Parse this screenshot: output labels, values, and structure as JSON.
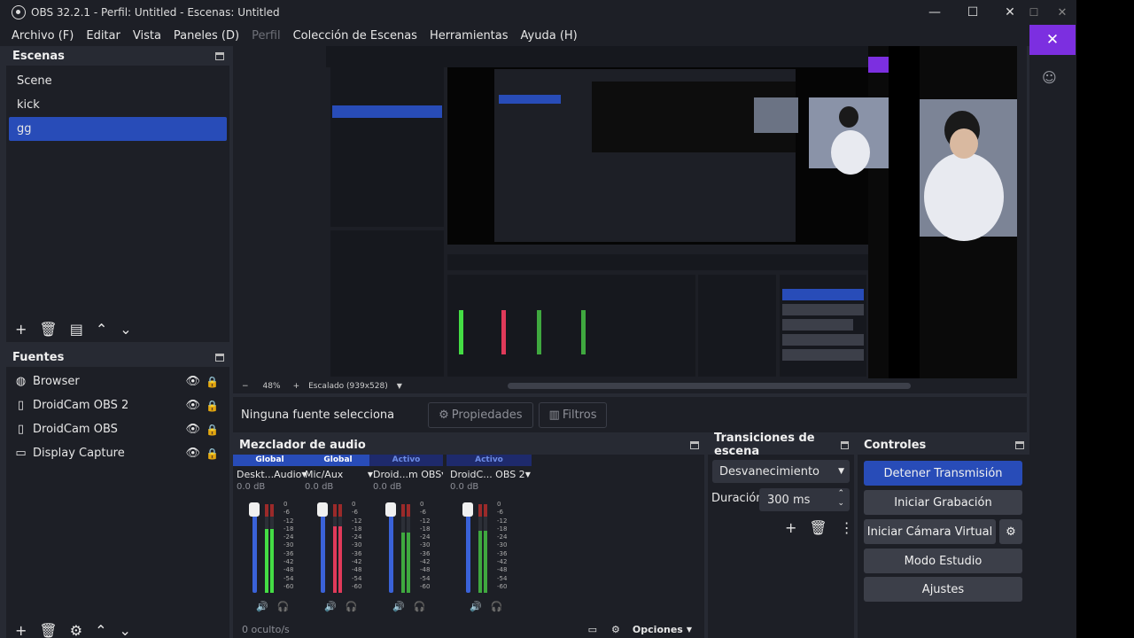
{
  "window": {
    "title": "OBS 32.2.1 - Perfil: Untitled - Escenas: Untitled",
    "controls": {
      "minimize": "—",
      "maximize": "☐",
      "close": "✕"
    },
    "outer_controls": {
      "maximize": "☐",
      "close": "✕"
    }
  },
  "menu": {
    "items": [
      "Archivo (F)",
      "Editar",
      "Vista",
      "Paneles (D)",
      "Perfil",
      "Colección de Escenas",
      "Herramientas",
      "Ayuda (H)"
    ],
    "disabled_index": 4
  },
  "scenes": {
    "title": "Escenas",
    "items": [
      "Scene",
      "kick",
      "gg"
    ],
    "selected_index": 2
  },
  "sources": {
    "title": "Fuentes",
    "items": [
      {
        "label": "Browser",
        "icon": "globe-icon"
      },
      {
        "label": "DroidCam OBS 2",
        "icon": "file-icon"
      },
      {
        "label": "DroidCam OBS",
        "icon": "file-icon"
      },
      {
        "label": "Display Capture",
        "icon": "monitor-icon"
      }
    ]
  },
  "preview_status": {
    "zoom": "48%",
    "scaling": "Escalado (939x528)",
    "zoom_out": "−",
    "zoom_in": "+"
  },
  "context": {
    "label": "Ninguna fuente selecciona",
    "properties": "Propiedades",
    "filters": "Filtros"
  },
  "mixer": {
    "title": "Mezclador de audio",
    "channels": [
      {
        "badge": "Global",
        "name": "Deskt...Audio",
        "db": "0.0 dB",
        "color": "#44dd44",
        "level": 0.72
      },
      {
        "badge": "Global",
        "name": "Mic/Aux",
        "db": "0.0 dB",
        "color": "#e03a5a",
        "level": 0.75
      },
      {
        "badge": "Activo",
        "name": "Droid...m OBS",
        "db": "0.0 dB",
        "color": "#3fa83f",
        "level": 0.68
      },
      {
        "badge": "Activo",
        "name": "DroidC... OBS 2",
        "db": "0.0 dB",
        "color": "#3fa83f",
        "level": 0.7
      }
    ],
    "ticks": [
      "0",
      "-6",
      "-12",
      "-18",
      "-24",
      "-30",
      "-36",
      "-42",
      "-48",
      "-54",
      "-60"
    ],
    "hidden_label": "0 oculto/s",
    "options_label": "Opciones"
  },
  "transitions": {
    "title": "Transiciones de escena",
    "selected": "Desvanecimiento",
    "duration_label": "Duración",
    "duration_value": "300 ms"
  },
  "controls": {
    "title": "Controles",
    "stop_stream": "Detener Transmisión",
    "start_recording": "Iniciar Grabación",
    "virtual_cam": "Iniciar Cámara Virtual",
    "studio_mode": "Modo Estudio",
    "settings": "Ajustes"
  },
  "colors": {
    "accent": "#284cb8",
    "panel_bg": "#1d1f26",
    "app_bg": "#272a33",
    "purple": "#7c2fe0"
  }
}
